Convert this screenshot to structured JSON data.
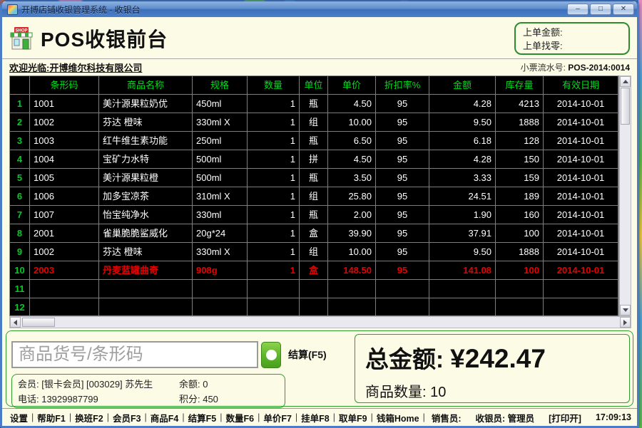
{
  "window": {
    "title": "开博店铺收银管理系统 - 收银台",
    "controls": {
      "minimize": "–",
      "maximize": "□",
      "close": "✕"
    }
  },
  "header": {
    "app_title": "POS收银前台",
    "shop_icon_text": "SHOP",
    "prev_amount_label": "上单金额:",
    "prev_change_label": "上单找零:",
    "welcome": "欢迎光临:开博维尔科技有限公司",
    "receipt_no_label": "小票流水号:",
    "receipt_no": "POS-2014:0014"
  },
  "table": {
    "columns": [
      "条形码",
      "商品名称",
      "规格",
      "数量",
      "单位",
      "单价",
      "折扣率%",
      "金额",
      "库存量",
      "有效日期"
    ],
    "rows": [
      {
        "no": "1",
        "barcode": "1001",
        "name": "美汁源果粒奶优",
        "spec": "450ml",
        "qty": "1",
        "unit": "瓶",
        "price": "4.50",
        "discount": "95",
        "amount": "4.28",
        "stock": "4213",
        "date": "2014-10-01"
      },
      {
        "no": "2",
        "barcode": "1002",
        "name": "芬达 橙味",
        "spec": "330ml X",
        "qty": "1",
        "unit": "组",
        "price": "10.00",
        "discount": "95",
        "amount": "9.50",
        "stock": "1888",
        "date": "2014-10-01"
      },
      {
        "no": "3",
        "barcode": "1003",
        "name": "红牛维生素功能",
        "spec": "250ml",
        "qty": "1",
        "unit": "瓶",
        "price": "6.50",
        "discount": "95",
        "amount": "6.18",
        "stock": "128",
        "date": "2014-10-01"
      },
      {
        "no": "4",
        "barcode": "1004",
        "name": "宝矿力水特",
        "spec": "500ml",
        "qty": "1",
        "unit": "拼",
        "price": "4.50",
        "discount": "95",
        "amount": "4.28",
        "stock": "150",
        "date": "2014-10-01"
      },
      {
        "no": "5",
        "barcode": "1005",
        "name": "美汁源果粒橙",
        "spec": "500ml",
        "qty": "1",
        "unit": "瓶",
        "price": "3.50",
        "discount": "95",
        "amount": "3.33",
        "stock": "159",
        "date": "2014-10-01"
      },
      {
        "no": "6",
        "barcode": "1006",
        "name": "加多宝凉茶",
        "spec": "310ml X",
        "qty": "1",
        "unit": "组",
        "price": "25.80",
        "discount": "95",
        "amount": "24.51",
        "stock": "189",
        "date": "2014-10-01"
      },
      {
        "no": "7",
        "barcode": "1007",
        "name": "怡宝纯净水",
        "spec": "330ml",
        "qty": "1",
        "unit": "瓶",
        "price": "2.00",
        "discount": "95",
        "amount": "1.90",
        "stock": "160",
        "date": "2014-10-01"
      },
      {
        "no": "8",
        "barcode": "2001",
        "name": "雀巢脆脆鲨威化",
        "spec": "20g*24",
        "qty": "1",
        "unit": "盒",
        "price": "39.90",
        "discount": "95",
        "amount": "37.91",
        "stock": "100",
        "date": "2014-10-01"
      },
      {
        "no": "9",
        "barcode": "1002",
        "name": "芬达 橙味",
        "spec": "330ml X",
        "qty": "1",
        "unit": "组",
        "price": "10.00",
        "discount": "95",
        "amount": "9.50",
        "stock": "1888",
        "date": "2014-10-01"
      },
      {
        "no": "10",
        "barcode": "2003",
        "name": "丹麦蓝罐曲奇",
        "spec": "908g",
        "qty": "1",
        "unit": "盒",
        "price": "148.50",
        "discount": "95",
        "amount": "141.08",
        "stock": "100",
        "date": "2014-10-01",
        "highlight": true
      },
      {
        "no": "11",
        "barcode": "",
        "name": "",
        "spec": "",
        "qty": "",
        "unit": "",
        "price": "",
        "discount": "",
        "amount": "",
        "stock": "",
        "date": ""
      },
      {
        "no": "12",
        "barcode": "",
        "name": "",
        "spec": "",
        "qty": "",
        "unit": "",
        "price": "",
        "discount": "",
        "amount": "",
        "stock": "",
        "date": ""
      }
    ]
  },
  "checkout": {
    "input_placeholder": "商品货号/条形码",
    "settle_label": "结算(F5)",
    "total_label": "总金额:",
    "total_value": "¥242.47",
    "qty_label": "商品数量:",
    "qty_value": "10"
  },
  "member": {
    "member_line": "会员: [银卡会员] [003029] 苏先生",
    "balance_line": "余额: 0",
    "phone_line": "电话: 13929987799",
    "points_line": "积分: 450"
  },
  "toolbar": {
    "divider": "|",
    "items": [
      "设置",
      "帮助F1",
      "换班F2",
      "会员F3",
      "商品F4",
      "结算F5",
      "数量F6",
      "单价F7",
      "挂单F8",
      "取单F9",
      "钱箱Home"
    ]
  },
  "statusbar": {
    "salesperson_label": "销售员:",
    "cashier_label": "收银员: 管理员",
    "print_status": "[打印开]",
    "time": "17:09:13"
  },
  "colors": {
    "accent_green": "#2f9e2f",
    "table_header_text": "#00dd1d",
    "highlight_red": "#e80000",
    "time_navy": "#000080"
  }
}
